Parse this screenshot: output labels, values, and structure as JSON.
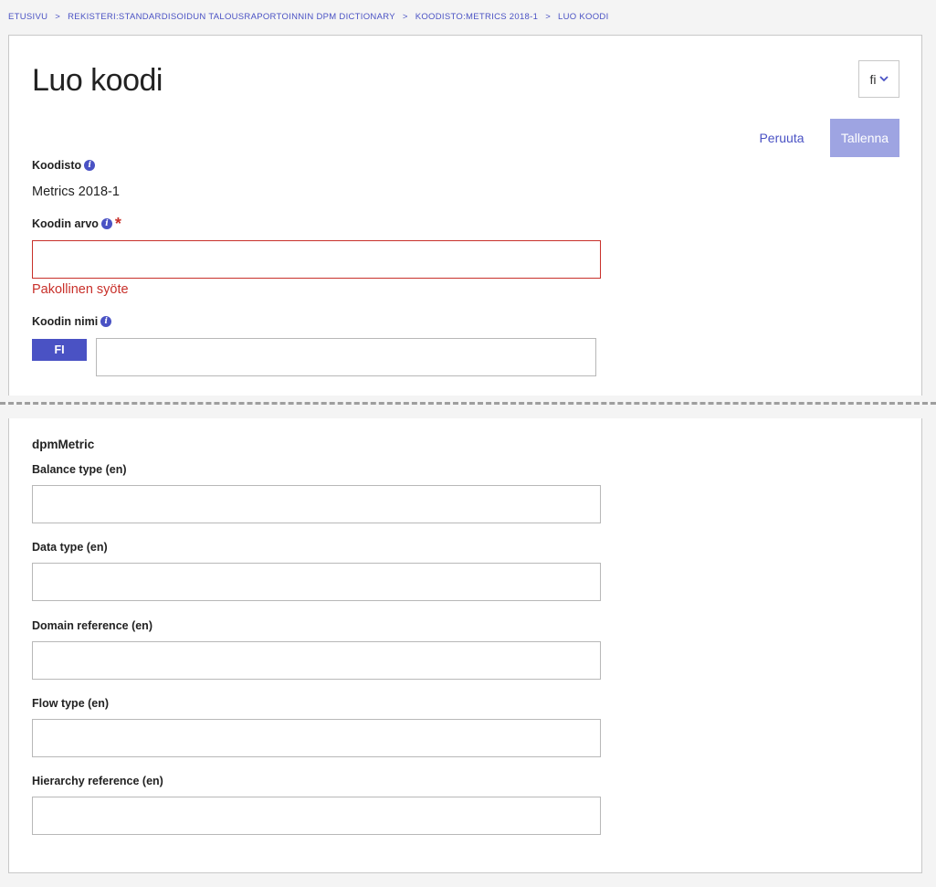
{
  "breadcrumb": {
    "items": [
      {
        "label": "ETUSIVU"
      },
      {
        "label": "REKISTERI:STANDARDISOIDUN TALOUSRAPORTOINNIN DPM DICTIONARY"
      },
      {
        "label": "KOODISTO:METRICS 2018-1"
      }
    ],
    "current": "LUO KOODI",
    "separator": ">"
  },
  "page": {
    "title": "Luo koodi",
    "language": "fi",
    "cancel_label": "Peruuta",
    "save_label": "Tallenna"
  },
  "form": {
    "codelist_label": "Koodisto",
    "codelist_value": "Metrics 2018-1",
    "code_value_label": "Koodin arvo",
    "code_value_value": "",
    "code_value_error": "Pakollinen syöte",
    "code_name_label": "Koodin nimi",
    "code_name_lang": "FI",
    "code_name_value": ""
  },
  "extension": {
    "title": "dpmMetric",
    "fields": [
      {
        "label": "Balance type (en)",
        "value": ""
      },
      {
        "label": "Data type (en)",
        "value": ""
      },
      {
        "label": "Domain reference (en)",
        "value": ""
      },
      {
        "label": "Flow type (en)",
        "value": ""
      },
      {
        "label": "Hierarchy reference (en)",
        "value": ""
      }
    ]
  },
  "colors": {
    "accent": "#4a52c4",
    "error": "#c8302a",
    "save_disabled": "#9ea4e2"
  }
}
